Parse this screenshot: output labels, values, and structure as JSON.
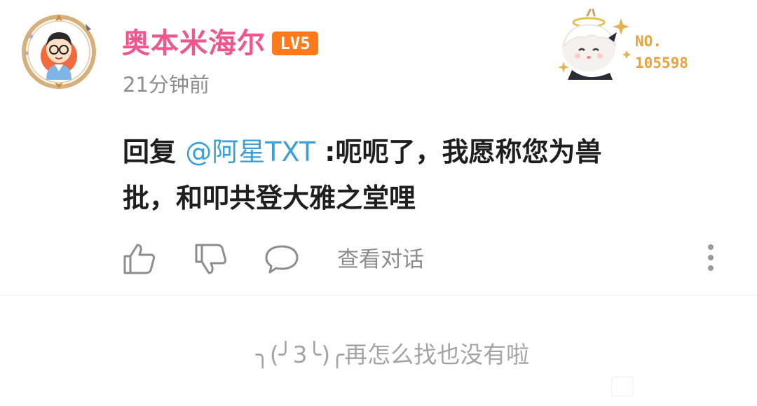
{
  "user": {
    "name": "奥本米海尔",
    "level": "LV5",
    "time": "21分钟前",
    "avatar_icon": "avatar-cartoon-boy-with-glasses-frame",
    "fan_badge": {
      "label": "NO.",
      "number": "105598",
      "icon": "paimon-fan-badge-icon"
    }
  },
  "comment": {
    "prefix": "回复",
    "mention": "@阿星TXT",
    "body_line1": ":呃呃了，我愿称您为兽",
    "body_line2": "批，和叩共登大雅之堂哩"
  },
  "actions": {
    "like_icon": "thumbs-up-icon",
    "dislike_icon": "thumbs-down-icon",
    "reply_icon": "speech-bubble-icon",
    "view_conversation": "查看对话",
    "more_icon": "vertical-ellipsis-icon"
  },
  "footer": {
    "end_text": "╮(╯3╰)╭再怎么找也没有啦"
  },
  "colors": {
    "username": "#f0568e",
    "level_badge": "#ff7a1a",
    "mention": "#3aa0d6",
    "muted": "#8d8d8d",
    "fan_number": "#e8a33a"
  }
}
